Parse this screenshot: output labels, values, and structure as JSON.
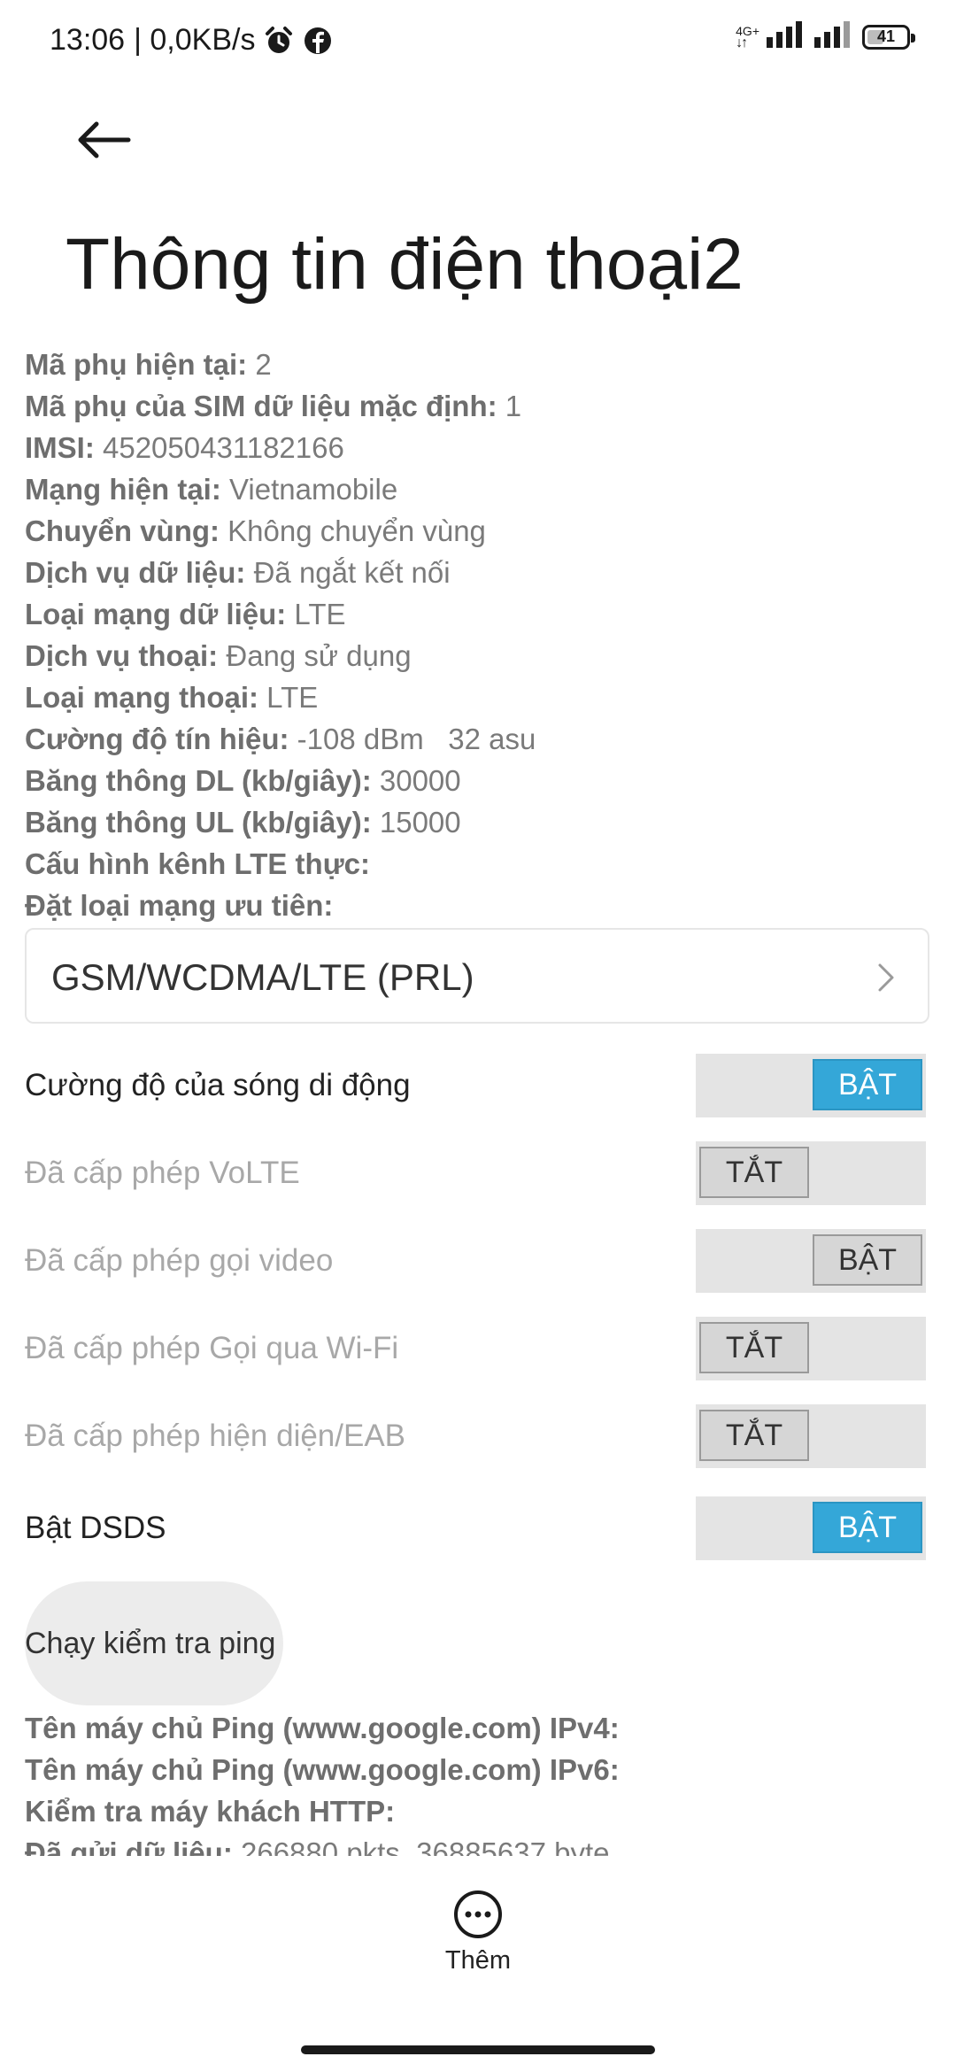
{
  "status_bar": {
    "time": "13:06",
    "speed": "| 0,0KB/s",
    "network_type": "4G+",
    "battery": "41",
    "battery_level": 0.41
  },
  "page": {
    "title": "Thông tin điện thoại2"
  },
  "info": [
    {
      "key": "Mã phụ hiện tại:",
      "value": "2"
    },
    {
      "key": "Mã phụ của SIM dữ liệu mặc định:",
      "value": "1"
    },
    {
      "key": "IMSI:",
      "value": "452050431182166"
    },
    {
      "key": "Mạng hiện tại:",
      "value": "Vietnamobile"
    },
    {
      "key": "Chuyển vùng:",
      "value": "Không chuyển vùng"
    },
    {
      "key": "Dịch vụ dữ liệu:",
      "value": "Đã ngắt kết nối"
    },
    {
      "key": "Loại mạng dữ liệu:",
      "value": "LTE"
    },
    {
      "key": "Dịch vụ thoại:",
      "value": "Đang sử dụng"
    },
    {
      "key": "Loại mạng thoại:",
      "value": "LTE"
    },
    {
      "key": "Cường độ tín hiệu:",
      "value": "-108 dBm   32 asu"
    },
    {
      "key": "Băng thông DL (kb/giây):",
      "value": "30000"
    },
    {
      "key": "Băng thông UL (kb/giây):",
      "value": "15000"
    },
    {
      "key": "Cấu hình kênh LTE thực:",
      "value": ""
    },
    {
      "key": "Đặt loại mạng ưu tiên:",
      "value": ""
    }
  ],
  "preferred_network": {
    "value": "GSM/WCDMA/LTE (PRL)"
  },
  "toggles": [
    {
      "label": "Cường độ của sóng di động",
      "state": "BẬT",
      "on": true,
      "enabled": true
    },
    {
      "label": "Đã cấp phép VoLTE",
      "state": "TẮT",
      "on": false,
      "enabled": false
    },
    {
      "label": "Đã cấp phép gọi video",
      "state": "BẬT",
      "on": true,
      "enabled": false
    },
    {
      "label": "Đã cấp phép Gọi qua Wi-Fi",
      "state": "TẮT",
      "on": false,
      "enabled": false
    },
    {
      "label": "Đã cấp phép hiện diện/EAB",
      "state": "TẮT",
      "on": false,
      "enabled": false
    },
    {
      "label": "Bật DSDS",
      "state": "BẬT",
      "on": true,
      "enabled": true
    }
  ],
  "ping": {
    "button_label": "Chạy kiểm tra ping",
    "results": [
      {
        "key": "Tên máy chủ Ping (www.google.com) IPv4:",
        "value": ""
      },
      {
        "key": "Tên máy chủ Ping (www.google.com) IPv6:",
        "value": ""
      },
      {
        "key": "Kiểm tra máy khách HTTP:",
        "value": ""
      },
      {
        "key": "Đã gửi dữ liệu:",
        "value": "266880 pkts, 36885637 byte"
      }
    ]
  },
  "bottom": {
    "more_label": "Thêm"
  },
  "colors": {
    "toggle_on": "#34a7d8",
    "toggle_off": "#d6d6d6"
  }
}
